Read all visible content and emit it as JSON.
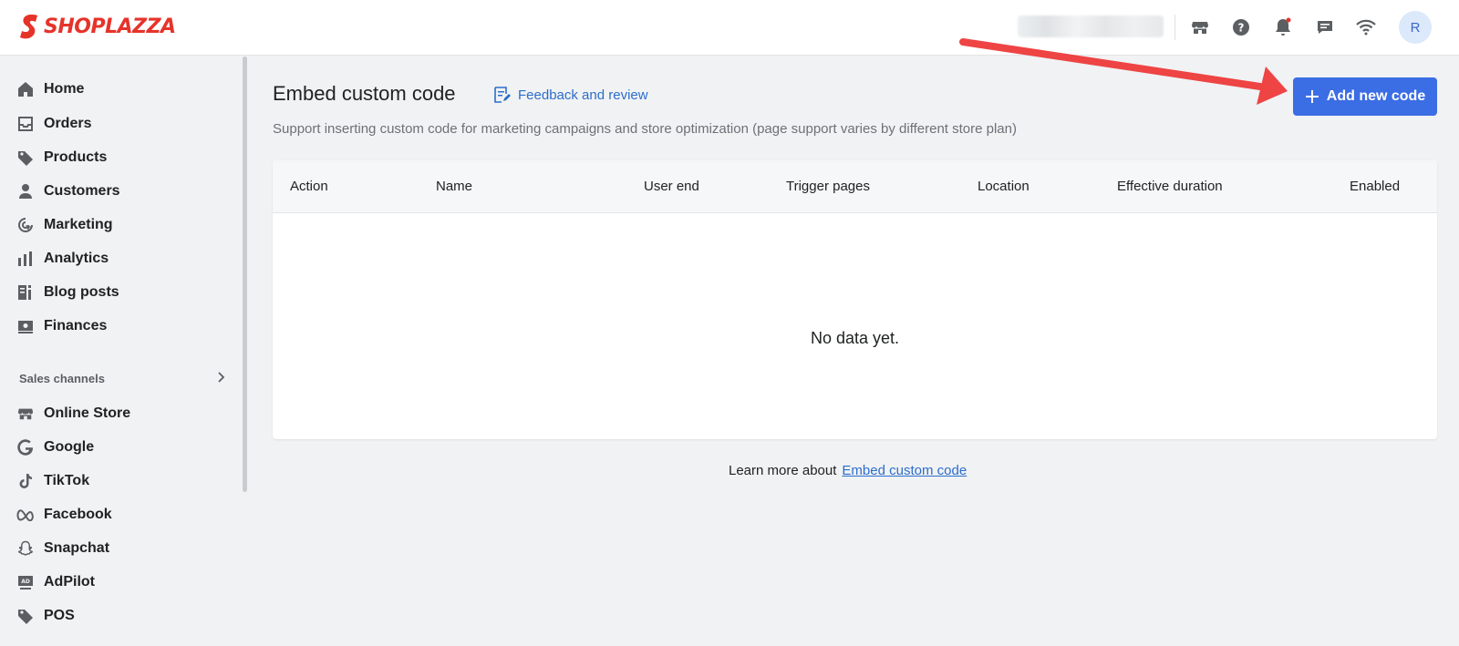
{
  "brand": {
    "name": "SHOPLAZZA",
    "color": "#e6332a"
  },
  "topbar": {
    "icons": [
      "store-icon",
      "help-icon",
      "bell-icon",
      "chat-icon",
      "wifi-icon"
    ],
    "avatar_letter": "R"
  },
  "sidebar": {
    "items": [
      {
        "label": "Home",
        "icon": "home-icon"
      },
      {
        "label": "Orders",
        "icon": "inbox-icon"
      },
      {
        "label": "Products",
        "icon": "tag-icon"
      },
      {
        "label": "Customers",
        "icon": "person-icon"
      },
      {
        "label": "Marketing",
        "icon": "target-icon"
      },
      {
        "label": "Analytics",
        "icon": "bar-chart-icon"
      },
      {
        "label": "Blog posts",
        "icon": "blog-icon"
      },
      {
        "label": "Finances",
        "icon": "finance-icon"
      }
    ],
    "sales_channels_label": "Sales channels",
    "channels": [
      {
        "label": "Online Store",
        "icon": "store-icon"
      },
      {
        "label": "Google",
        "icon": "google-icon"
      },
      {
        "label": "TikTok",
        "icon": "tiktok-icon"
      },
      {
        "label": "Facebook",
        "icon": "meta-icon"
      },
      {
        "label": "Snapchat",
        "icon": "snapchat-icon"
      },
      {
        "label": "AdPilot",
        "icon": "adpilot-icon"
      },
      {
        "label": "POS",
        "icon": "pos-tag-icon"
      }
    ]
  },
  "main": {
    "title": "Embed custom code",
    "feedback_link": "Feedback and review",
    "subtitle": "Support inserting custom code for marketing campaigns and store optimization (page support varies by different store plan)",
    "add_button": "Add new code",
    "table": {
      "columns": [
        "Action",
        "Name",
        "User end",
        "Trigger pages",
        "Location",
        "Effective duration",
        "Enabled"
      ],
      "empty_text": "No data yet."
    },
    "learn_more_prefix": "Learn more about",
    "learn_more_link": "Embed custom code"
  },
  "colors": {
    "primary_button": "#3b6de4",
    "link": "#2c6ecb",
    "annotation_arrow": "#ee4444"
  }
}
